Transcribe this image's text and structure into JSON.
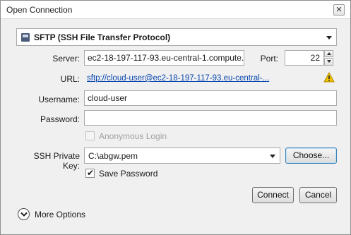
{
  "window": {
    "title": "Open Connection",
    "close_glyph": "✕"
  },
  "protocol": {
    "selected": "SFTP (SSH File Transfer Protocol)"
  },
  "server": {
    "label": "Server:",
    "value": "ec2-18-197-117-93.eu-central-1.compute."
  },
  "port": {
    "label": "Port:",
    "value": "22"
  },
  "url": {
    "label": "URL:",
    "value": "sftp://cloud-user@ec2-18-197-117-93.eu-central-..."
  },
  "username": {
    "label": "Username:",
    "value": "cloud-user"
  },
  "password": {
    "label": "Password:",
    "value": ""
  },
  "anonymous": {
    "label": "Anonymous Login",
    "checked": false,
    "enabled": false
  },
  "ssh_key": {
    "label": "SSH Private Key:",
    "value": "C:\\abgw.pem",
    "choose_label": "Choose..."
  },
  "save_password": {
    "label": "Save Password",
    "checked": true
  },
  "buttons": {
    "connect": "Connect",
    "cancel": "Cancel"
  },
  "more_options": {
    "label": "More Options"
  },
  "colors": {
    "link": "#0645ad",
    "warning": "#f2c200",
    "focus": "#3c7fb1"
  }
}
